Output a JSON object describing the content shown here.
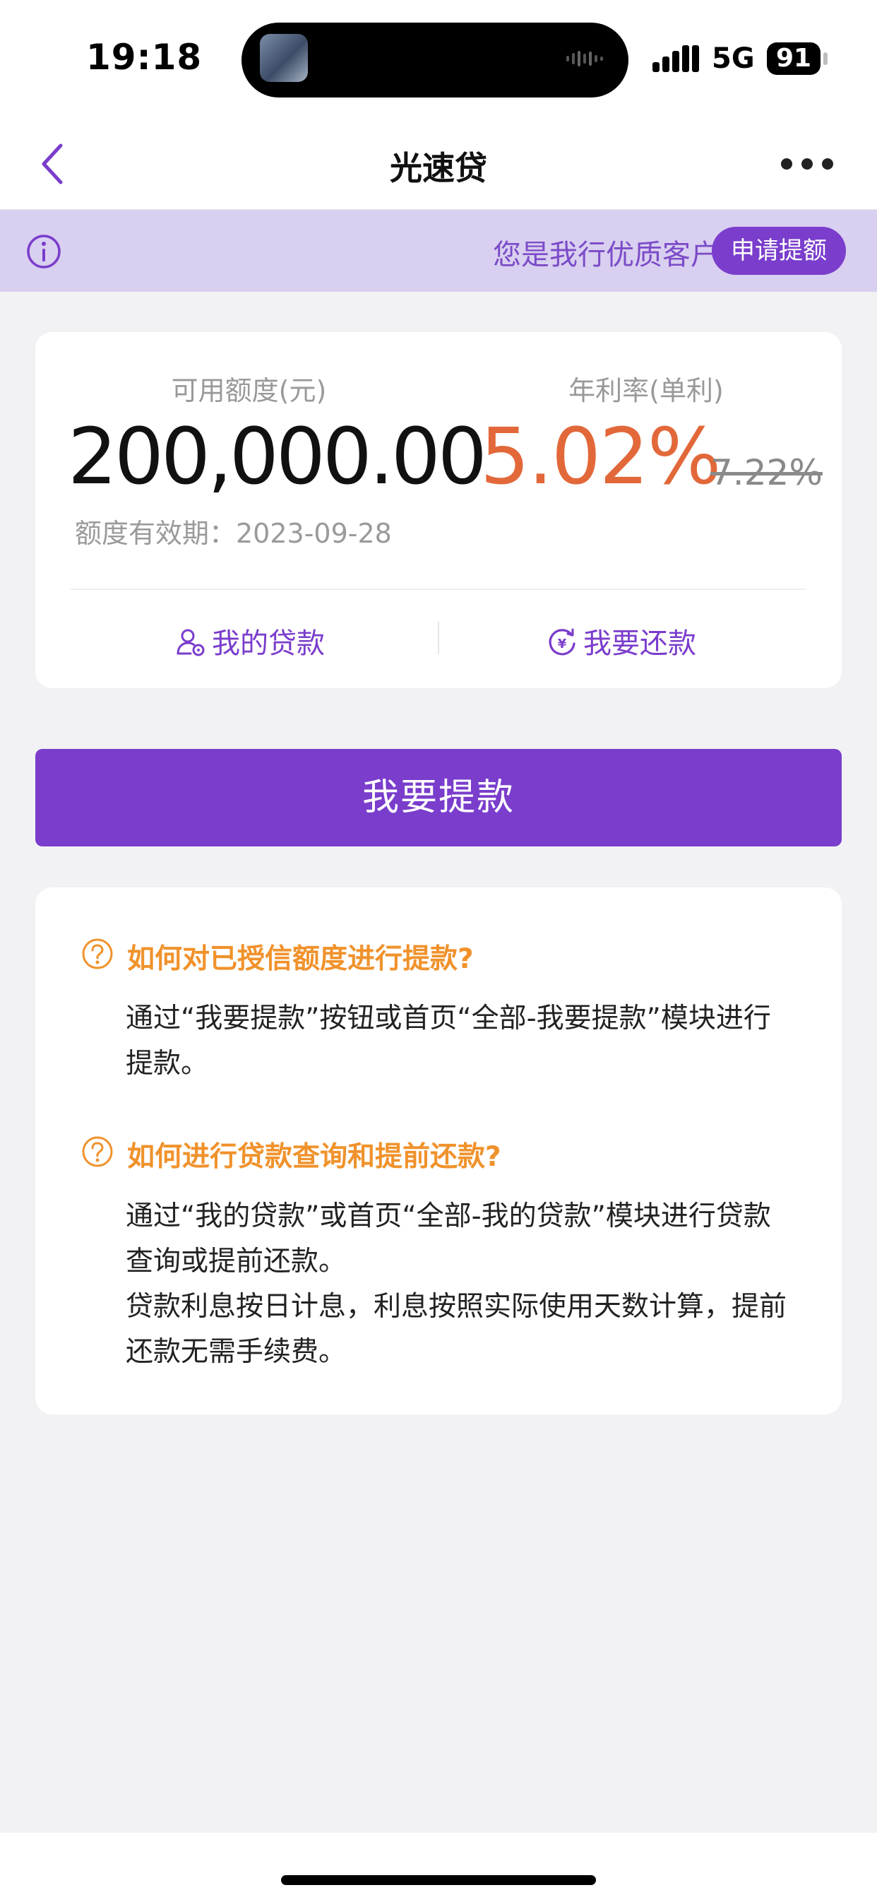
{
  "status_bar": {
    "time": "19:18",
    "network": "5G",
    "battery": "91"
  },
  "nav": {
    "title": "光速贷",
    "back_icon": "chevron-left-icon",
    "more_icon": "more-dots-icon"
  },
  "banner": {
    "text": "您是我行优质客户",
    "button": "申请提额",
    "icon": "info-icon"
  },
  "credit": {
    "available_label": "可用额度(元)",
    "available_amount": "200,000.00",
    "validity": "额度有效期：2023-09-28",
    "rate_label": "年利率(单利)",
    "rate": "5.02%",
    "original_rate": "7.22%",
    "links": [
      {
        "label": "我的贷款",
        "icon": "user-loan-icon"
      },
      {
        "label": "我要还款",
        "icon": "yuan-refresh-icon"
      }
    ]
  },
  "action": {
    "withdraw_label": "我要提款"
  },
  "faq": [
    {
      "question": "如何对已授信额度进行提款?",
      "answer_lines": [
        "通过“我要提款”按钮或首页“全部-我要提款”模块进行",
        "提款。"
      ]
    },
    {
      "question": "如何进行贷款查询和提前还款?",
      "answer_lines": [
        "通过“我的贷款”或首页“全部-我的贷款”模块进行贷款",
        "查询或提前还款。",
        "贷款利息按日计息，利息按照实际使用天数计算，提前",
        "还款无需手续费。"
      ]
    }
  ],
  "colors": {
    "primary": "#7a3dcc",
    "rate": "#e2683a",
    "faq_title": "#f0922c",
    "banner_bg": "#d9cff0"
  }
}
